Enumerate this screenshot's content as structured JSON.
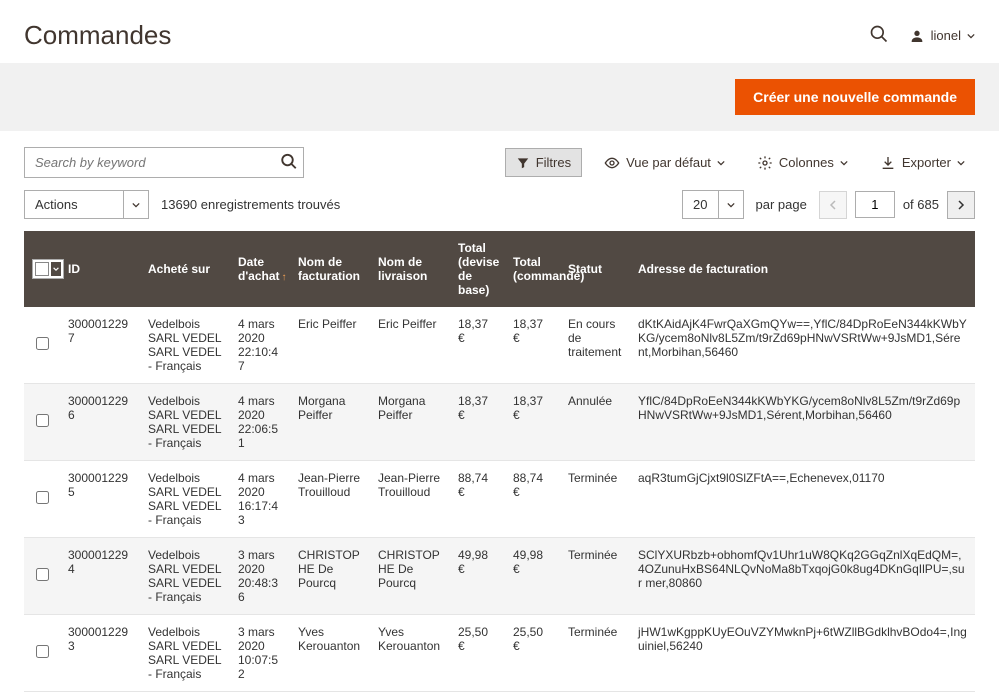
{
  "header": {
    "title": "Commandes",
    "user": "lionel"
  },
  "action_bar": {
    "create_label": "Créer une nouvelle commande"
  },
  "search": {
    "placeholder": "Search by keyword"
  },
  "toolbar": {
    "filters": "Filtres",
    "default_view": "Vue par défaut",
    "columns": "Colonnes",
    "export": "Exporter"
  },
  "actions": {
    "label": "Actions",
    "count_text": "13690 enregistrements trouvés"
  },
  "pager": {
    "page_size": "20",
    "per_page_label": "par page",
    "current": "1",
    "of_label": "of",
    "total": "685"
  },
  "columns": {
    "id": "ID",
    "store": "Acheté sur",
    "date": "Date d'achat",
    "bill_name": "Nom de facturation",
    "ship_name": "Nom de livraison",
    "total_base": "Total (devise de base)",
    "total_ordered": "Total (commandé)",
    "status": "Statut",
    "bill_addr": "Adresse de facturation"
  },
  "rows": [
    {
      "id": "3000012297",
      "store": "Vedelbois\n  SARL VEDEL\n    SARL VEDEL - Français",
      "date": "4 mars 2020 22:10:47",
      "bill_name": "Eric Peiffer",
      "ship_name": "Eric Peiffer",
      "total_base": "18,37 €",
      "total_ordered": "18,37 €",
      "status": "En cours de traitement",
      "bill_addr": "dKtKAidAjK4FwrQaXGmQYw==,YflC/84DpRoEeN344kKWbYKG/ycem8oNlv8L5Zm/t9rZd69pHNwVSRtWw+9JsMD1,Sérent,Morbihan,56460"
    },
    {
      "id": "3000012296",
      "store": "Vedelbois\n  SARL VEDEL\n    SARL VEDEL - Français",
      "date": "4 mars 2020 22:06:51",
      "bill_name": "Morgana Peiffer",
      "ship_name": "Morgana Peiffer",
      "total_base": "18,37 €",
      "total_ordered": "18,37 €",
      "status": "Annulée",
      "bill_addr": "YflC/84DpRoEeN344kKWbYKG/ycem8oNlv8L5Zm/t9rZd69pHNwVSRtWw+9JsMD1,Sérent,Morbihan,56460"
    },
    {
      "id": "3000012295",
      "store": "Vedelbois\n  SARL VEDEL\n    SARL VEDEL - Français",
      "date": "4 mars 2020 16:17:43",
      "bill_name": "Jean-Pierre Trouilloud",
      "ship_name": "Jean-Pierre Trouilloud",
      "total_base": "88,74 €",
      "total_ordered": "88,74 €",
      "status": "Terminée",
      "bill_addr": "aqR3tumGjCjxt9l0SlZFtA==,Echenevex,01170"
    },
    {
      "id": "3000012294",
      "store": "Vedelbois\n  SARL VEDEL\n    SARL VEDEL - Français",
      "date": "3 mars 2020 20:48:36",
      "bill_name": "CHRISTOPHE De Pourcq",
      "ship_name": "CHRISTOPHE De Pourcq",
      "total_base": "49,98 €",
      "total_ordered": "49,98 €",
      "status": "Terminée",
      "bill_addr": "SClYXURbzb+obhomfQv1Uhr1uW8QKq2GGqZnlXqEdQM=,4OZunuHxBS64NLQvNoMa8bTxqojG0k8ug4DKnGqIlPU=,sur mer,80860"
    },
    {
      "id": "3000012293",
      "store": "Vedelbois\n  SARL VEDEL\n    SARL VEDEL - Français",
      "date": "3 mars 2020 10:07:52",
      "bill_name": "Yves Kerouanton",
      "ship_name": "Yves Kerouanton",
      "total_base": "25,50 €",
      "total_ordered": "25,50 €",
      "status": "Terminée",
      "bill_addr": "jHW1wKgppKUyEOuVZYMwknPj+6tWZllBGdklhvBOdo4=,Inguiniel,56240"
    }
  ]
}
